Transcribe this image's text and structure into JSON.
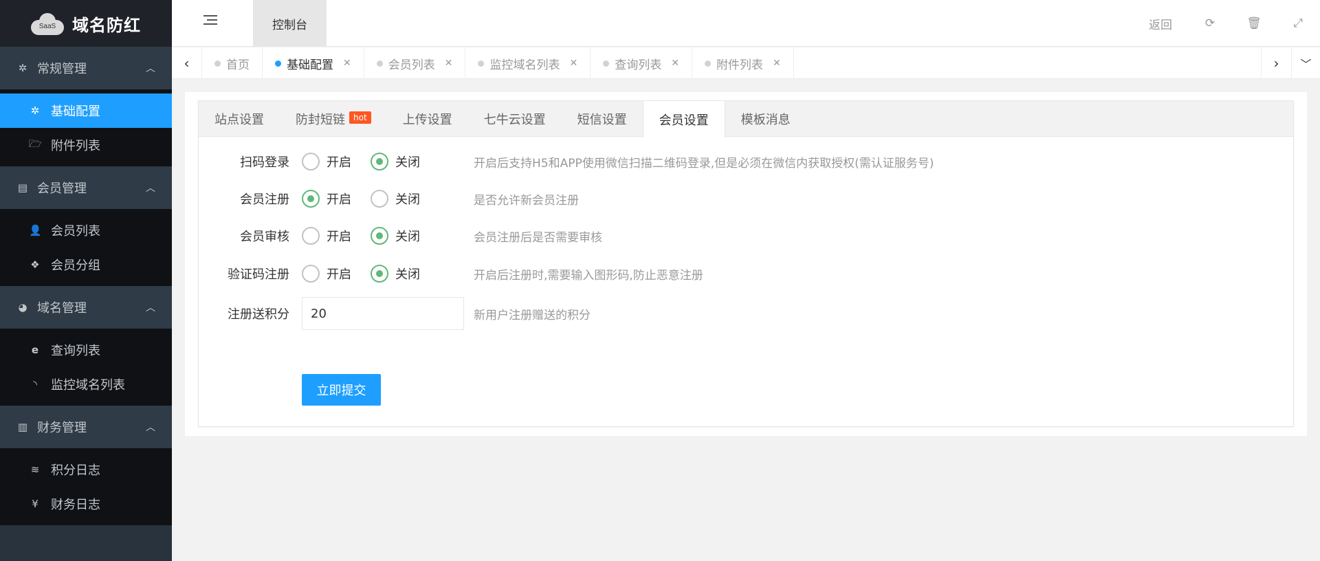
{
  "app": {
    "brand": "域名防红",
    "logo_badge": "SaaS"
  },
  "sidebar": {
    "groups": [
      {
        "label": "常规管理",
        "icon": "gear-icon",
        "items": [
          {
            "label": "基础配置",
            "icon": "gear-icon",
            "active": true
          },
          {
            "label": "附件列表",
            "icon": "folder-open-icon"
          }
        ]
      },
      {
        "label": "会员管理",
        "icon": "id-card-icon",
        "items": [
          {
            "label": "会员列表",
            "icon": "user-icon"
          },
          {
            "label": "会员分组",
            "icon": "cubes-icon"
          }
        ]
      },
      {
        "label": "域名管理",
        "icon": "firefox-icon",
        "items": [
          {
            "label": "查询列表",
            "icon": "ie-icon"
          },
          {
            "label": "监控域名列表",
            "icon": "rss-icon"
          }
        ]
      },
      {
        "label": "财务管理",
        "icon": "file-text-icon",
        "items": [
          {
            "label": "积分日志",
            "icon": "database-icon"
          },
          {
            "label": "财务日志",
            "icon": "yen-icon"
          }
        ]
      }
    ]
  },
  "header": {
    "tab": "控制台",
    "back": "返回"
  },
  "tabs": [
    {
      "label": "首页",
      "closable": false
    },
    {
      "label": "基础配置",
      "closable": true,
      "active": true
    },
    {
      "label": "会员列表",
      "closable": true
    },
    {
      "label": "监控域名列表",
      "closable": true
    },
    {
      "label": "查询列表",
      "closable": true
    },
    {
      "label": "附件列表",
      "closable": true
    }
  ],
  "panel": {
    "tabs": [
      "站点设置",
      "防封短链",
      "上传设置",
      "七牛云设置",
      "短信设置",
      "会员设置",
      "模板消息"
    ],
    "hot_badge": "hot",
    "active_tab": "会员设置",
    "on_label": "开启",
    "off_label": "关闭",
    "fields": [
      {
        "label": "扫码登录",
        "value": "off",
        "help": "开启后支持H5和APP使用微信扫描二维码登录,但是必须在微信内获取授权(需认证服务号)"
      },
      {
        "label": "会员注册",
        "value": "on",
        "help": "是否允许新会员注册"
      },
      {
        "label": "会员审核",
        "value": "off",
        "help": "会员注册后是否需要审核"
      },
      {
        "label": "验证码注册",
        "value": "off",
        "help": "开启后注册时,需要输入图形码,防止恶意注册"
      }
    ],
    "points_field": {
      "label": "注册送积分",
      "value": "20",
      "help": "新用户注册赠送的积分"
    },
    "submit": "立即提交"
  },
  "colors": {
    "primary": "#1e9fff",
    "radio_on": "#5fb878",
    "hot": "#ff5722",
    "sidebar_bg": "#28333e"
  }
}
